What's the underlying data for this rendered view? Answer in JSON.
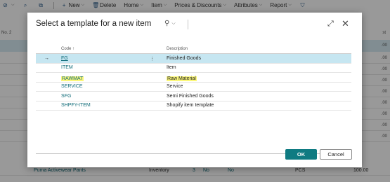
{
  "actionbar": {
    "new": "New",
    "delete": "Delete",
    "home": "Home",
    "item": "Item",
    "prices": "Prices & Discounts",
    "attributes": "Attributes",
    "report": "Report"
  },
  "background": {
    "col_no": "No. 2",
    "col_cost": "st",
    "num1": ".00",
    "bottom_row": {
      "name": "Puma Activewear Pants",
      "type": "Inventory",
      "qty": "3",
      "flag1": "No",
      "flag2": "No",
      "uom": "PCS",
      "amount": "100.00"
    }
  },
  "dialog": {
    "title": "Select a template for a new item",
    "columns": {
      "code": "Code ↑",
      "description": "Description"
    },
    "rows": [
      {
        "code": "FG",
        "description": "Finished Goods"
      },
      {
        "code": "ITEM",
        "description": "Item"
      },
      {
        "code": "RAWMAT",
        "description": "Raw Material"
      },
      {
        "code": "SERVICE",
        "description": "Service"
      },
      {
        "code": "SFG",
        "description": "Semi Finished Goods"
      },
      {
        "code": "SHPFY-ITEM",
        "description": "Shopify item template"
      }
    ],
    "ok_label": "OK",
    "cancel_label": "Cancel"
  },
  "colors": {
    "accent": "#0f7b82",
    "selected_row": "#c6e6f1",
    "highlight": "#fbf77a",
    "link": "#0f6b78"
  },
  "icons": [
    "filter-icon",
    "search-icon",
    "share-icon",
    "new-icon",
    "delete-icon",
    "expand-icon",
    "close-icon",
    "row-arrow-icon",
    "more-options-icon"
  ]
}
